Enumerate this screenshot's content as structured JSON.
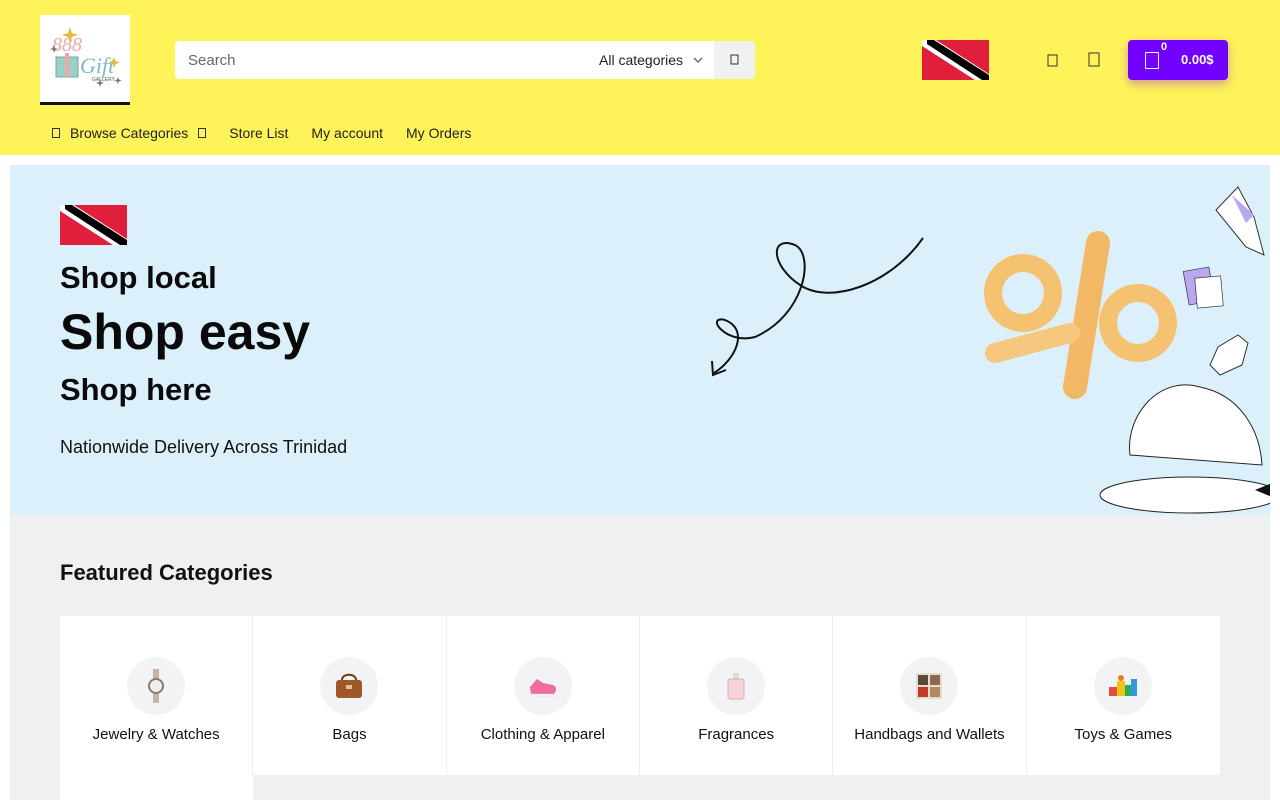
{
  "header": {
    "logo_alt": "888 Gift Gallery",
    "search": {
      "placeholder": "Search",
      "category": "All categories"
    },
    "cart": {
      "count": "0",
      "total": "0.00$"
    },
    "icons": [
      "search-icon",
      "flag-trinidad",
      "user-icon",
      "heart-icon",
      "cart-icon"
    ]
  },
  "nav": {
    "items": [
      {
        "label": "Browse Categories"
      },
      {
        "label": "Store List"
      },
      {
        "label": "My account"
      },
      {
        "label": "My Orders"
      }
    ]
  },
  "hero": {
    "line1": "Shop local",
    "line2": "Shop easy",
    "line3": "Shop here",
    "delivery": "Nationwide Delivery Across Trinidad"
  },
  "featured": {
    "title": "Featured Categories",
    "categories": [
      {
        "label": "Jewelry & Watches",
        "icon": "watch-icon"
      },
      {
        "label": "Bags",
        "icon": "bag-icon"
      },
      {
        "label": "Clothing & Apparel",
        "icon": "sneaker-icon"
      },
      {
        "label": "Fragrances",
        "icon": "perfume-icon"
      },
      {
        "label": "Handbags and Wallets",
        "icon": "wallet-icon"
      },
      {
        "label": "Toys & Games",
        "icon": "toys-icon"
      }
    ]
  },
  "colors": {
    "header_bg": "#fff35a",
    "accent": "#7200ff",
    "hero_bg": "#dcf0fc",
    "section_bg": "#eef0f2"
  }
}
